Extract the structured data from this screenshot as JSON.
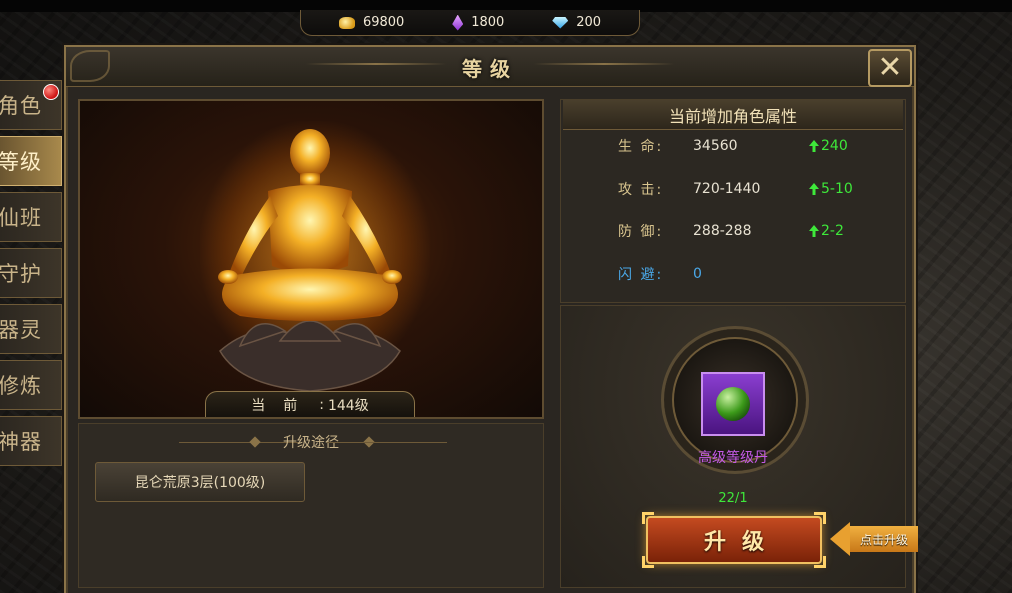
{
  "currencies": [
    {
      "icon": "gold-ingot-icon",
      "value": "69800"
    },
    {
      "icon": "purple-crystal-icon",
      "value": "1800"
    },
    {
      "icon": "diamond-icon",
      "value": "200"
    }
  ],
  "window": {
    "title": "等级"
  },
  "side_tabs": [
    {
      "label": "角色",
      "active": false,
      "badge": true
    },
    {
      "label": "等级",
      "active": true,
      "badge": false
    },
    {
      "label": "仙班",
      "active": false,
      "badge": false
    },
    {
      "label": "守护",
      "active": false,
      "badge": false
    },
    {
      "label": "器灵",
      "active": false,
      "badge": false
    },
    {
      "label": "修炼",
      "active": false,
      "badge": false
    },
    {
      "label": "神器",
      "active": false,
      "badge": false
    }
  ],
  "level": {
    "key": "当前",
    "separator": ":",
    "value": "144级"
  },
  "upgrade_path": {
    "header": "升级途径",
    "option": "昆仑荒原3层(100级)"
  },
  "attributes": {
    "header": "当前增加角色属性",
    "rows": [
      {
        "name": "生 命:",
        "value": "34560",
        "increase": "240",
        "color": "normal"
      },
      {
        "name": "攻 击:",
        "value": "720-1440",
        "increase": "5-10",
        "color": "normal"
      },
      {
        "name": "防 御:",
        "value": "288-288",
        "increase": "2-2",
        "color": "normal"
      },
      {
        "name": "闪 避:",
        "value": "0",
        "increase": "",
        "color": "blue"
      }
    ]
  },
  "item": {
    "name": "高级等级丹",
    "count": "22/1"
  },
  "upgrade_button": {
    "label": "升级"
  },
  "hint": {
    "label": "点击升级"
  },
  "colors": {
    "accent_gold": "#8a7348",
    "increase_green": "#3ee83a",
    "item_purple": "#c45ae6",
    "dodge_blue": "#4aa8e8"
  }
}
